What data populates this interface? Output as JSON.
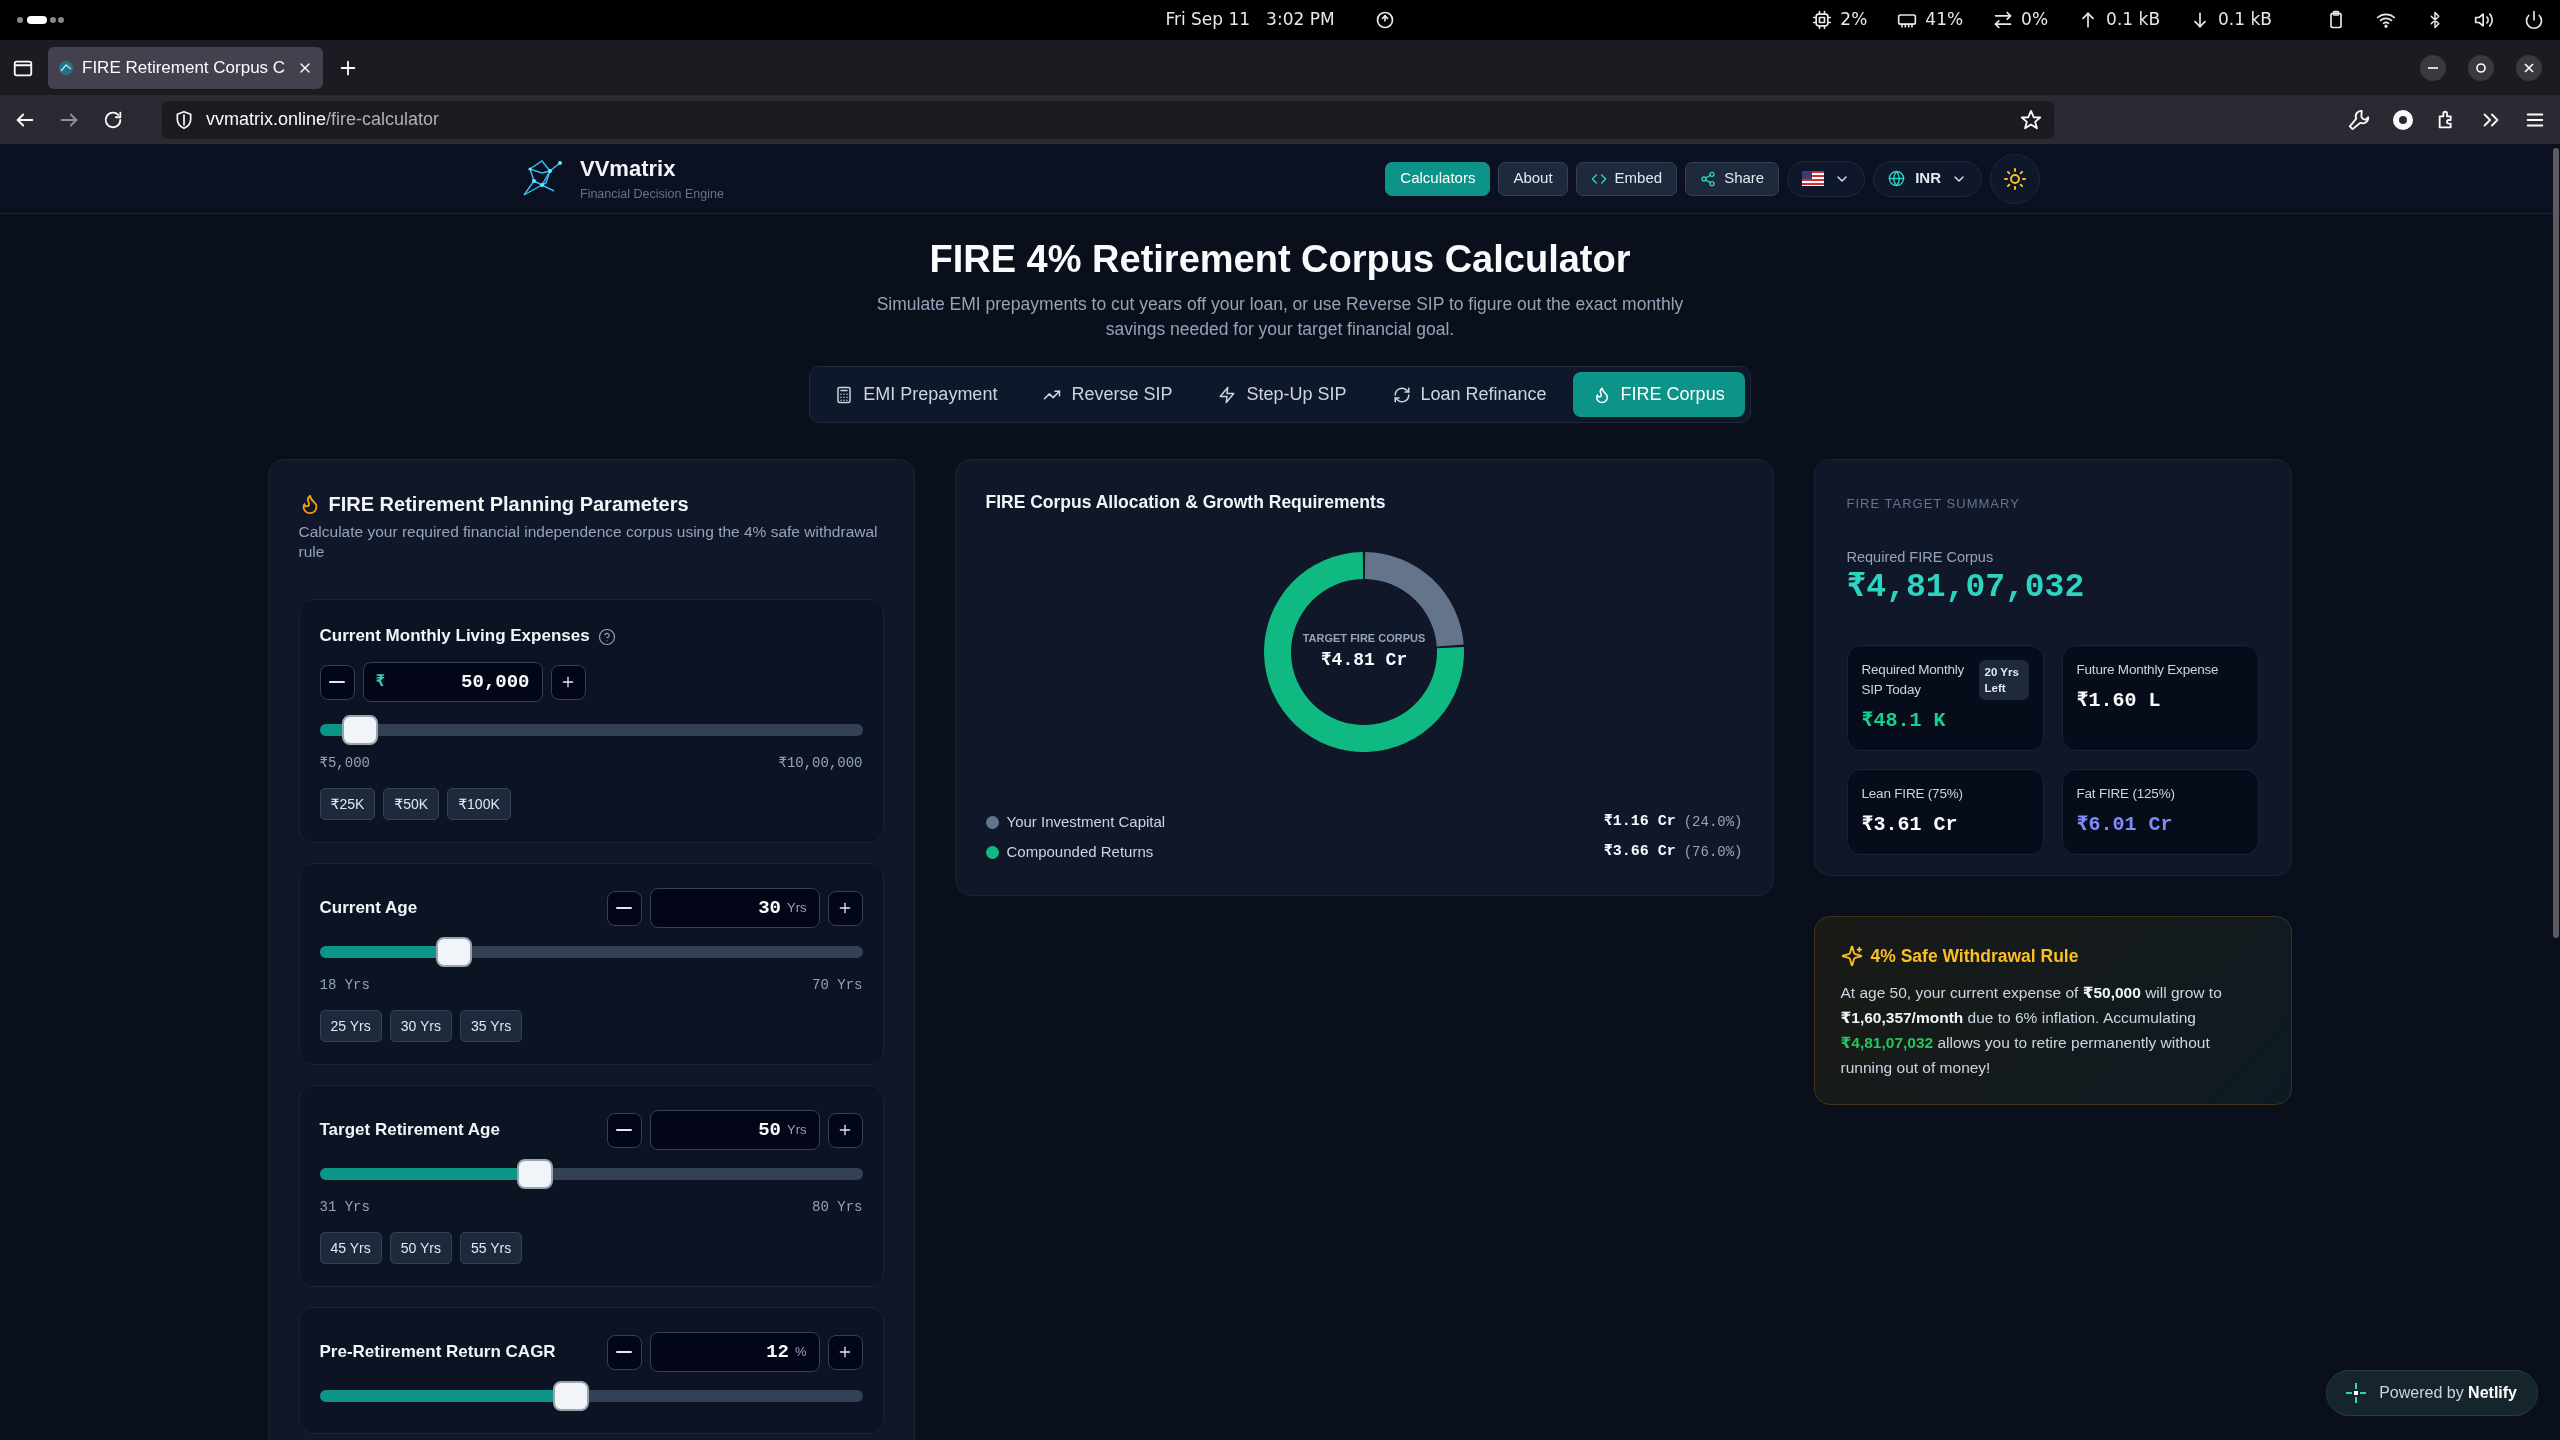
{
  "os_bar": {
    "date": "Fri Sep 11",
    "time": "3:02 PM",
    "stats": [
      {
        "text": "2%"
      },
      {
        "text": "41%"
      },
      {
        "text": "0%"
      },
      {
        "text": "0.1 kB"
      },
      {
        "text": "0.1 kB"
      }
    ]
  },
  "browser": {
    "tab_title": "FIRE Retirement Corpus C",
    "url_host": "vvmatrix.online",
    "url_path": "/fire-calculator"
  },
  "header": {
    "brand": "VVmatrix",
    "tagline": "Financial Decision Engine",
    "nav": [
      {
        "label": "Calculators",
        "selected": true
      },
      {
        "label": "About",
        "selected": false
      },
      {
        "label": "Embed",
        "selected": false
      },
      {
        "label": "Share",
        "selected": false
      }
    ],
    "currency": "INR"
  },
  "page": {
    "title": "FIRE 4% Retirement Corpus Calculator",
    "subtitle": "Simulate EMI prepayments to cut years off your loan, or use Reverse SIP to figure out the exact monthly savings needed for your target financial goal."
  },
  "tabs": [
    {
      "label": "EMI Prepayment",
      "selected": false
    },
    {
      "label": "Reverse SIP",
      "selected": false
    },
    {
      "label": "Step-Up SIP",
      "selected": false
    },
    {
      "label": "Loan Refinance",
      "selected": false
    },
    {
      "label": "FIRE Corpus",
      "selected": true
    }
  ],
  "parameters": {
    "title": "FIRE Retirement Planning Parameters",
    "subtitle": "Calculate your required financial independence corpus using the 4% safe withdrawal rule",
    "fields": [
      {
        "kind": "stacked",
        "label": "Current Monthly Living Expenses",
        "help": true,
        "prefix": "₹",
        "value": "50,000",
        "level": 0.045,
        "min": "₹5,000",
        "max": "₹10,00,000",
        "presets": [
          "₹25K",
          "₹50K",
          "₹100K"
        ]
      },
      {
        "kind": "inline",
        "label": "Current Age",
        "help": false,
        "value": "30",
        "unit": "Yrs",
        "level": 0.23,
        "min": "18 Yrs",
        "max": "70 Yrs",
        "presets": [
          "25 Yrs",
          "30 Yrs",
          "35 Yrs"
        ]
      },
      {
        "kind": "inline",
        "label": "Target Retirement Age",
        "help": false,
        "value": "50",
        "unit": "Yrs",
        "level": 0.39,
        "min": "31 Yrs",
        "max": "80 Yrs",
        "presets": [
          "45 Yrs",
          "50 Yrs",
          "55 Yrs"
        ]
      },
      {
        "kind": "inline",
        "label": "Pre-Retirement Return CAGR",
        "help": false,
        "value": "12",
        "unit": "%",
        "level": 0.46
      }
    ]
  },
  "chart": {
    "title": "FIRE Corpus Allocation & Growth Requirements",
    "center_label": "TARGET FIRE CORPUS",
    "center_value": "₹4.81 Cr",
    "chart_data": {
      "type": "donut",
      "categories": [
        "Your Investment Capital",
        "Compounded Returns"
      ],
      "values": [
        24.0,
        76.0
      ]
    },
    "legend": [
      {
        "color": "#64748b",
        "amount": "₹1.16 Cr",
        "share": "(24.0%)"
      },
      {
        "color": "#10b981",
        "amount": "₹3.66 Cr",
        "share": "(76.0%)"
      }
    ]
  },
  "summary": {
    "heading": "FIRE TARGET SUMMARY",
    "corpus_label": "Required FIRE Corpus",
    "corpus_value": "₹4,81,07,032",
    "tiles": [
      {
        "label": "Required Monthly SIP Today",
        "badge": "20 Yrs Left",
        "value": "₹48.1 K",
        "color": "#10d48e"
      },
      {
        "label": "Future Monthly Expense",
        "value": "₹1.60 L",
        "color": "#f8fafc"
      },
      {
        "label": "Lean FIRE (75%)",
        "value": "₹3.61 Cr",
        "color": "#f8fafc"
      },
      {
        "label": "Fat FIRE (125%)",
        "value": "₹6.01 Cr",
        "color": "#818cf8"
      }
    ]
  },
  "rule": {
    "title": "4% Safe Withdrawal Rule",
    "paragraph": [
      {
        "kind": "plain",
        "text": "At age 50, your current expense of **₹50,000** will grow to **₹1,60,357/month** due to 6% inflation. Accumulating "
      },
      {
        "kind": "highlight",
        "text": "₹4,81,07,032"
      },
      {
        "kind": "plain",
        "text": " allows you to retire permanently without running out of money!"
      }
    ]
  },
  "badge": {
    "text": "Powered by **Netlify**"
  }
}
